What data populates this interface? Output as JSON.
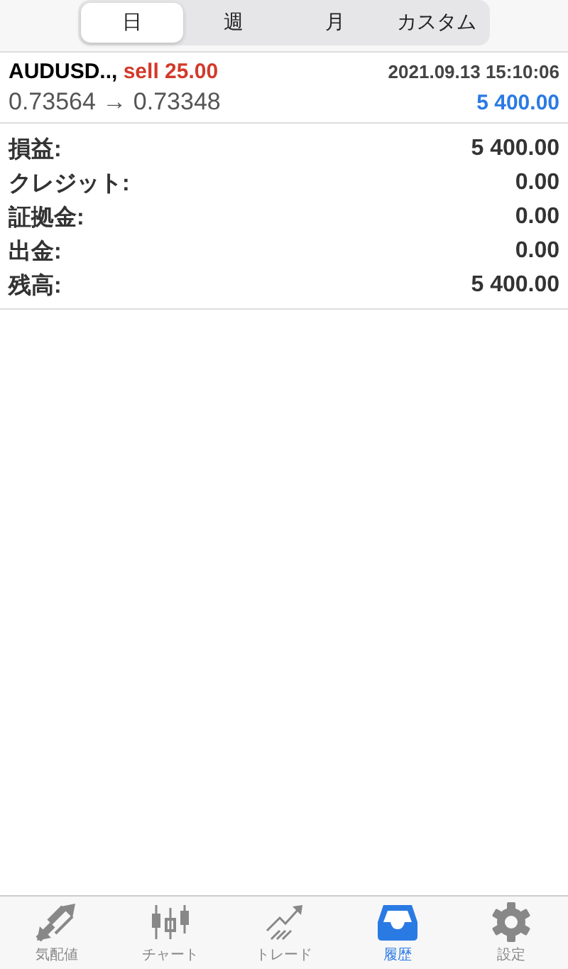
{
  "tabs": [
    {
      "label": "日",
      "selected": true
    },
    {
      "label": "週",
      "selected": false
    },
    {
      "label": "月",
      "selected": false
    },
    {
      "label": "カスタム",
      "selected": false
    }
  ],
  "deal": {
    "symbol": "AUDUSD..,",
    "order": "sell 25.00",
    "time": "2021.09.13 15:10:06",
    "prices": "0.73564 → 0.73348",
    "profit": "5 400.00"
  },
  "summary": [
    {
      "label": "損益:",
      "value": "5 400.00"
    },
    {
      "label": "クレジット:",
      "value": "0.00"
    },
    {
      "label": "証拠金:",
      "value": "0.00"
    },
    {
      "label": "出金:",
      "value": "0.00"
    },
    {
      "label": "残高:",
      "value": "5 400.00"
    }
  ],
  "nav": [
    {
      "kind": "quotes",
      "label": "気配値",
      "selected": false
    },
    {
      "kind": "chart",
      "label": "チャート",
      "selected": false
    },
    {
      "kind": "trade",
      "label": "トレード",
      "selected": false
    },
    {
      "kind": "history",
      "label": "履歴",
      "selected": true
    },
    {
      "kind": "settings",
      "label": "設定",
      "selected": false
    }
  ]
}
